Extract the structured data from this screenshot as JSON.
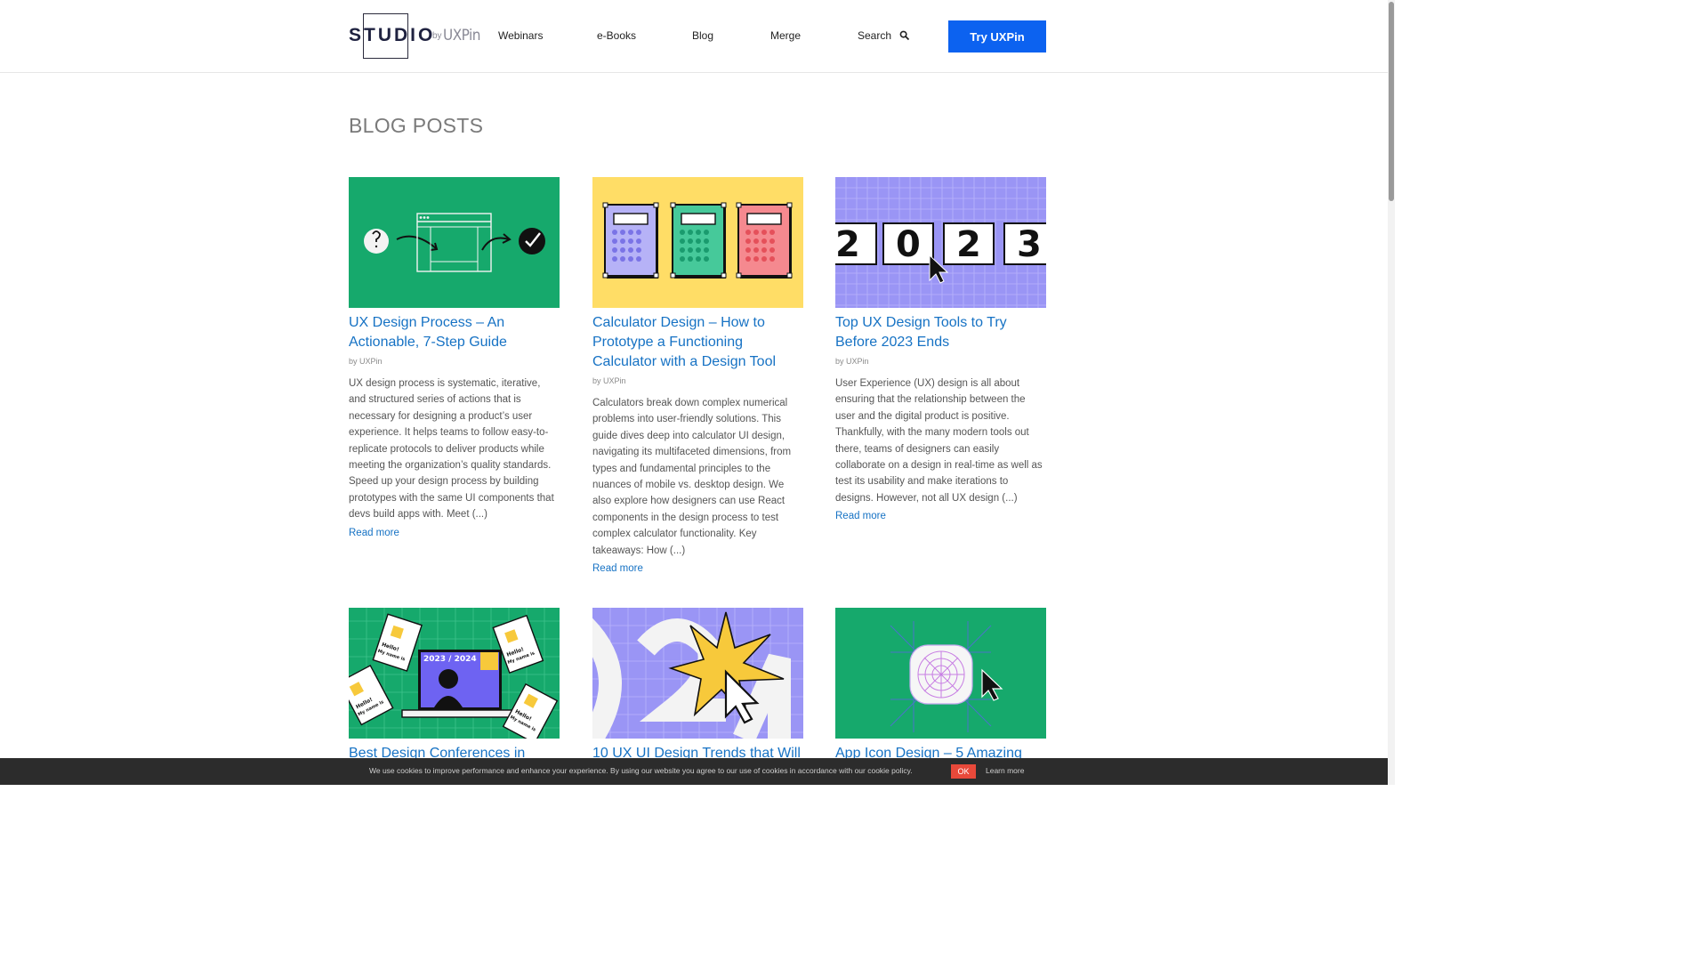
{
  "header": {
    "logo_text": "STUDIO",
    "logo_by": "by",
    "logo_brand": "UXPin",
    "nav": [
      "Webinars",
      "e-Books",
      "Blog",
      "Merge",
      "Search"
    ],
    "cta_label": "Try UXPin"
  },
  "section_title": "BLOG POSTS",
  "posts": [
    {
      "title": "UX Design Process – An Actionable, 7-Step Guide",
      "byline_prefix": "by",
      "author": "UXPin",
      "excerpt": "UX design process is systematic, iterative, and structured series of actions that is necessary for designing a product’s user experience. It helps teams to follow easy-to-replicate protocols to deliver products while meeting the organization’s quality standards. Speed up your design process by building prototypes with the same UI components that devs build apps with. Meet (...)",
      "read_more": "Read more"
    },
    {
      "title": "Calculator Design – How to Prototype a Functioning Calculator with a Design Tool",
      "byline_prefix": "by",
      "author": "UXPin",
      "excerpt": "Calculators break down complex numerical problems into user-friendly solutions. This guide dives deep into calculator UI design, navigating its multifaceted dimensions, from types and fundamental principles to the nuances of mobile vs. desktop design. We also explore how designers can use React components in the design process to test complex calculator functionality. Key takeaways: How (...)",
      "read_more": "Read more"
    },
    {
      "title": "Top UX Design Tools to Try Before 2023 Ends",
      "byline_prefix": "by",
      "author": "UXPin",
      "excerpt": "User Experience (UX) design is all about ensuring that the relationship between the user and the digital product is positive. Thankfully, with the many modern tools out there, teams of designers can easily collaborate on a design in real-time as well as test its usability and make iterations to designs. However, not all UX design (...)",
      "read_more": "Read more"
    },
    {
      "title": "Best Design Conferences in"
    },
    {
      "title": "10 UX UI Design Trends that Will"
    },
    {
      "title": "App Icon Design – 5 Amazing"
    }
  ],
  "thumb_text": {
    "year_digits": [
      "2",
      "0",
      "2",
      "3"
    ],
    "conference_year": "2023 / 2024",
    "badge_hello": "Hello!",
    "badge_name": "My name is"
  },
  "cookie": {
    "text": "We use cookies to improve performance and enhance your experience. By using our website you agree to our use of cookies in accordance with our cookie policy.",
    "ok": "OK",
    "learn_more": "Learn more"
  },
  "colors": {
    "accent": "#0c62f0",
    "link": "#1672c4",
    "green": "#16a96c",
    "yellow": "#ffdd66",
    "purple": "#9a95f5",
    "cookie_ok": "#e8493a"
  }
}
